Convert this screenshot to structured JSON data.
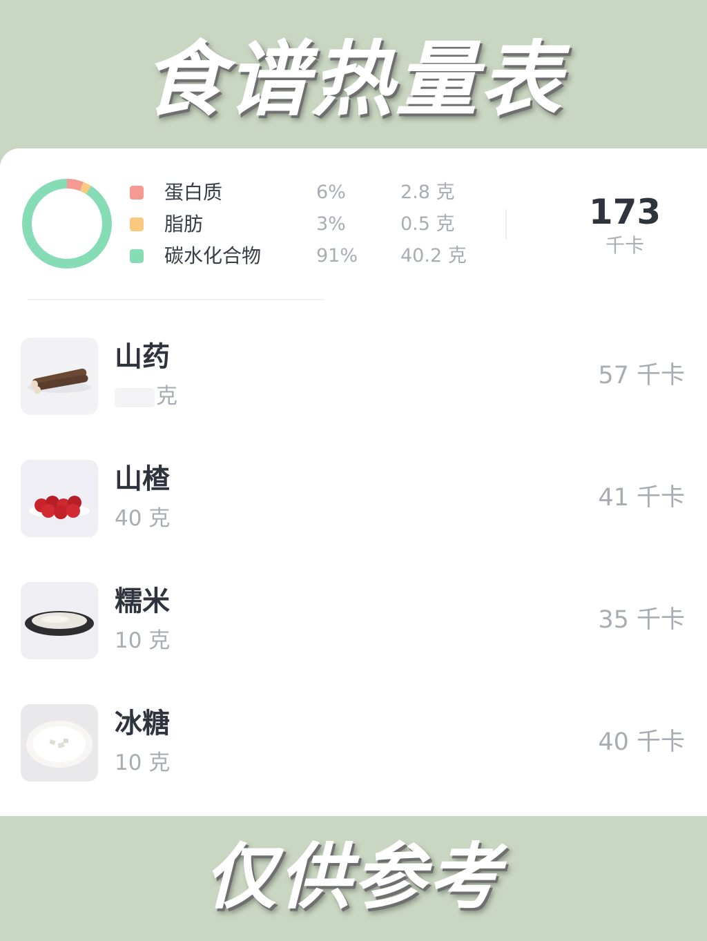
{
  "header": {
    "title": "食谱热量表"
  },
  "footer": {
    "title": "仅供参考"
  },
  "summary": {
    "nutrients": [
      {
        "name": "蛋白质",
        "percent": "6%",
        "amount": "2.8 克",
        "color": "#f59a92",
        "share": 0.06
      },
      {
        "name": "脂肪",
        "percent": "3%",
        "amount": "0.5 克",
        "color": "#f8c97e",
        "share": 0.03
      },
      {
        "name": "碳水化合物",
        "percent": "91%",
        "amount": "40.2 克",
        "color": "#86dcb5",
        "share": 0.91
      }
    ],
    "total_kcal": "173",
    "kcal_unit": "千卡"
  },
  "ingredients": [
    {
      "name": "山药",
      "weight": "克",
      "kcal": "57 千卡",
      "icon": "yam-image"
    },
    {
      "name": "山楂",
      "weight": "40 克",
      "kcal": "41 千卡",
      "icon": "hawthorn-image"
    },
    {
      "name": "糯米",
      "weight": "10 克",
      "kcal": "35 千卡",
      "icon": "rice-image"
    },
    {
      "name": "冰糖",
      "weight": "10 克",
      "kcal": "40 千卡",
      "icon": "rock-sugar-image"
    }
  ]
}
